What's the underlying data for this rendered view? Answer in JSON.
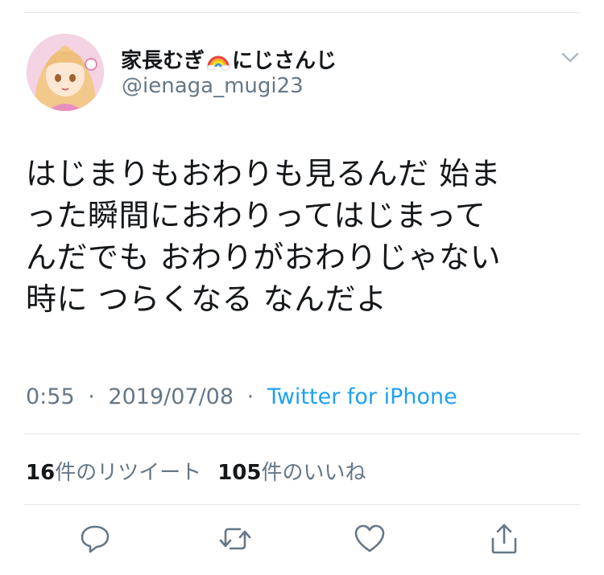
{
  "tweet": {
    "display_name": "家長むぎ",
    "display_name_suffix": "にじさんじ",
    "display_name_emoji": "rainbow-emoji",
    "handle": "@ienaga_mugi23",
    "text": "はじまりもおわりも見るんだ 始ま\nった瞬間におわりってはじまって\nんだでも おわりがおわりじゃない\n時に つらくなる なんだよ",
    "time": "0:55",
    "date": "2019/07/08",
    "separator": "·",
    "source": "Twitter for iPhone",
    "retweets_count": "16",
    "retweets_label": "件のリツイート",
    "likes_count": "105",
    "likes_label": "件のいいね"
  },
  "icons": {
    "menu": "chevron-down-icon",
    "reply": "reply-icon",
    "retweet": "retweet-icon",
    "like": "heart-icon",
    "share": "share-icon"
  },
  "colors": {
    "text": "#14171a",
    "secondary": "#657786",
    "link": "#1da1f2",
    "divider": "#e1e8ed",
    "icon": "#657786"
  }
}
